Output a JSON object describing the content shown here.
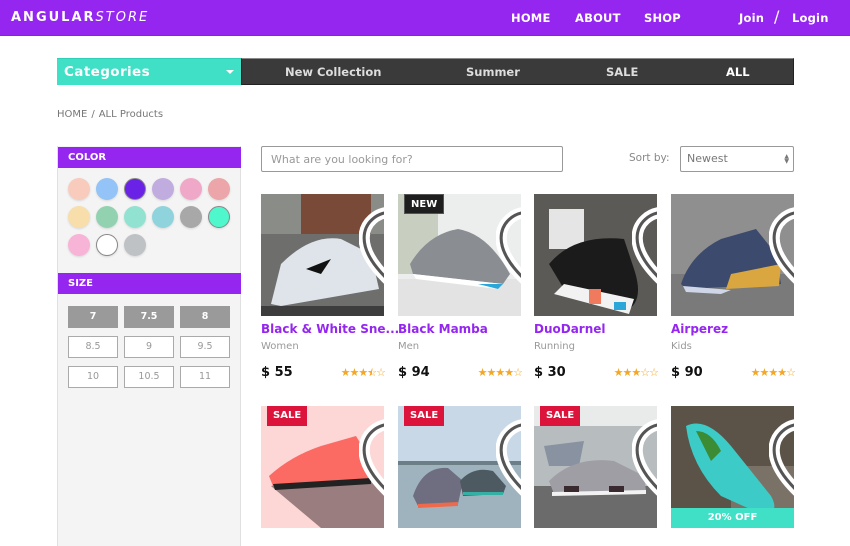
{
  "header": {
    "logo_bold": "ANGULAR",
    "logo_thin": "STORE",
    "nav": [
      "HOME",
      "ABOUT",
      "SHOP"
    ],
    "join": "Join",
    "separator": "/",
    "login": "Login",
    "brand_color": "#9526f0"
  },
  "categories": {
    "dropdown_label": "Categories",
    "links": [
      "New Collection",
      "Summer",
      "SALE",
      "ALL"
    ],
    "active_link": "ALL",
    "accent_color": "#3fe0c5"
  },
  "breadcrumb": {
    "home": "HOME",
    "separator": "/",
    "current": "ALL Products"
  },
  "filters": {
    "color_title": "COLOR",
    "colors": [
      {
        "hex": "#f8cbbd",
        "selected": false
      },
      {
        "hex": "#93c3f7",
        "selected": false
      },
      {
        "hex": "#6a22e6",
        "selected": true
      },
      {
        "hex": "#c1acdf",
        "selected": false
      },
      {
        "hex": "#f0a8c8",
        "selected": false
      },
      {
        "hex": "#eca5a8",
        "selected": false
      },
      {
        "hex": "#f8deaa",
        "selected": false
      },
      {
        "hex": "#93d2b1",
        "selected": false
      },
      {
        "hex": "#91e2d0",
        "selected": false
      },
      {
        "hex": "#8fd3dc",
        "selected": false
      },
      {
        "hex": "#a8a8a8",
        "selected": false
      },
      {
        "hex": "#4ef7cc",
        "selected": true
      },
      {
        "hex": "#f7b4d6",
        "selected": false
      },
      {
        "hex": "#ffffff",
        "selected": true
      },
      {
        "hex": "#bfc2c5",
        "selected": false
      }
    ],
    "size_title": "SIZE",
    "sizes": [
      {
        "label": "7",
        "active": true
      },
      {
        "label": "7.5",
        "active": true
      },
      {
        "label": "8",
        "active": true
      },
      {
        "label": "8.5",
        "active": false
      },
      {
        "label": "9",
        "active": false
      },
      {
        "label": "9.5",
        "active": false
      },
      {
        "label": "10",
        "active": false
      },
      {
        "label": "10.5",
        "active": false
      },
      {
        "label": "11",
        "active": false
      }
    ]
  },
  "search": {
    "placeholder": "What are you looking for?",
    "value": ""
  },
  "sort": {
    "label": "Sort by:",
    "selected": "Newest"
  },
  "products": [
    {
      "name": "Black & White Sne...",
      "category": "Women",
      "price": "$ 55",
      "rating": 3.5,
      "badge": "",
      "discount": "",
      "image": "white-sneaker"
    },
    {
      "name": "Black Mamba",
      "category": "Men",
      "price": "$ 94",
      "rating": 4,
      "badge": "NEW",
      "discount": "",
      "image": "grey-runner"
    },
    {
      "name": "DuoDarnel",
      "category": "Running",
      "price": "$ 30",
      "rating": 3,
      "badge": "",
      "discount": "",
      "image": "black-nmd"
    },
    {
      "name": "Airperez",
      "category": "Kids",
      "price": "$ 90",
      "rating": 4,
      "badge": "",
      "discount": "",
      "image": "navy-gold-basketball"
    },
    {
      "name": "",
      "category": "",
      "price": "",
      "rating": null,
      "badge": "SALE",
      "discount": "",
      "image": "coral-sneaker"
    },
    {
      "name": "",
      "category": "",
      "price": "",
      "rating": null,
      "badge": "SALE",
      "discount": "",
      "image": "pair-on-water"
    },
    {
      "name": "",
      "category": "",
      "price": "",
      "rating": null,
      "badge": "SALE",
      "discount": "",
      "image": "grey-nmd-steps"
    },
    {
      "name": "",
      "category": "",
      "price": "",
      "rating": null,
      "badge": "",
      "discount": "20% OFF",
      "image": "teal-sneaker"
    }
  ]
}
